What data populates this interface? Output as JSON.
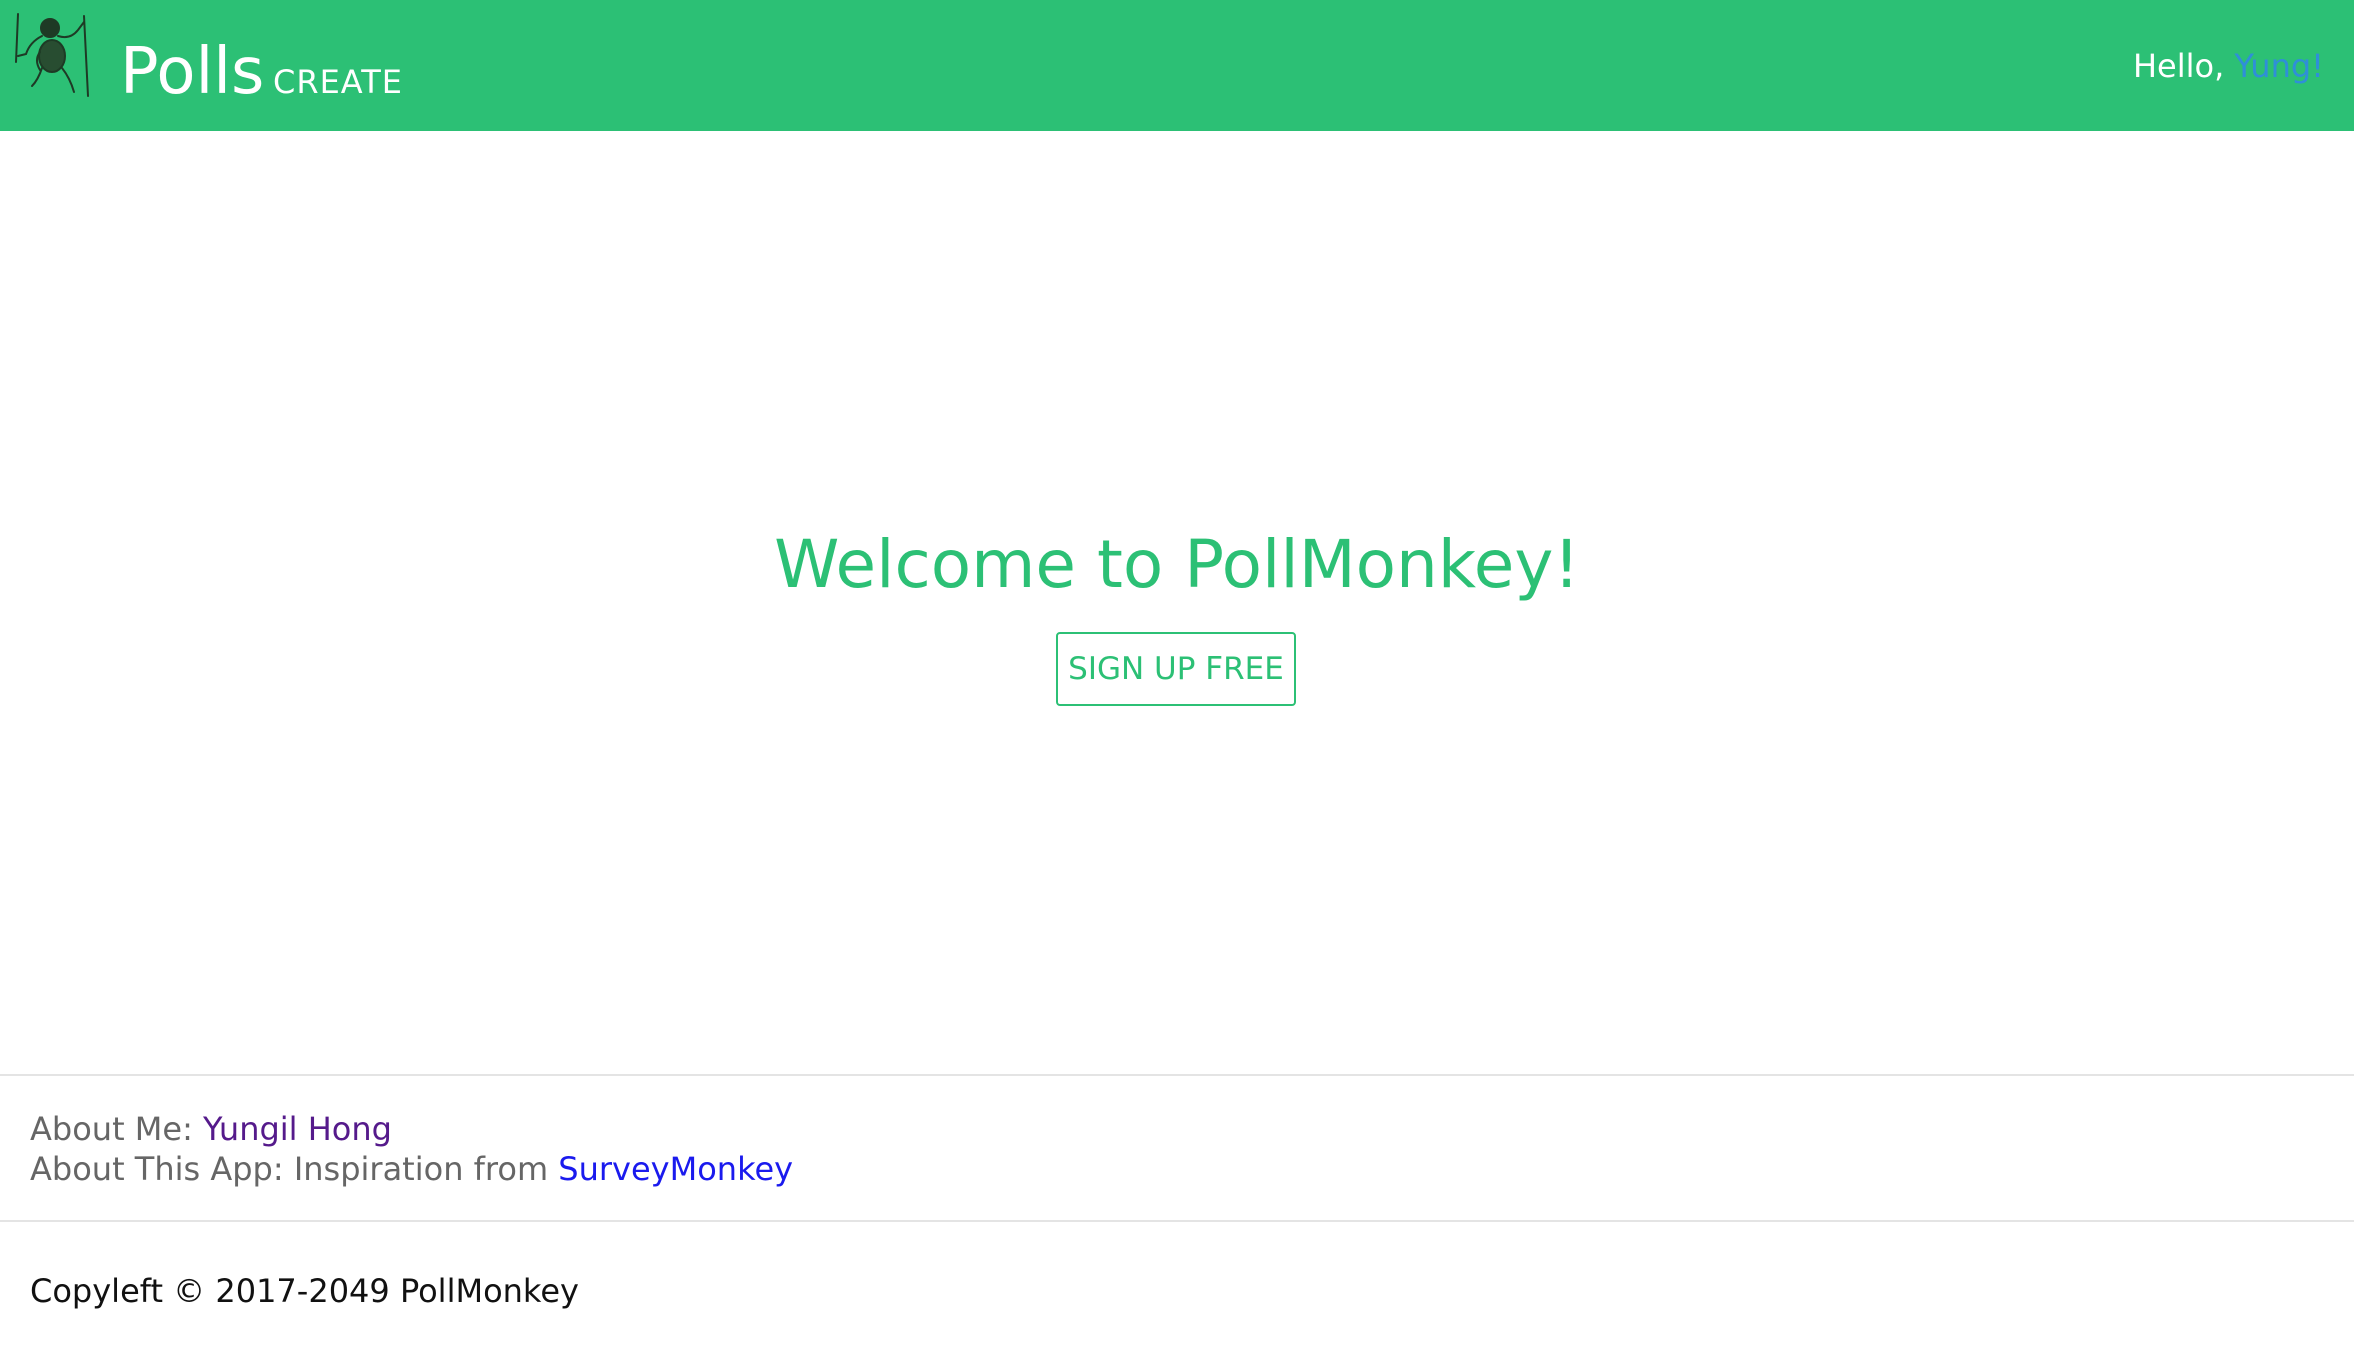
{
  "navbar": {
    "brand": "Polls",
    "create_link": "CREATE",
    "greeting": "Hello,",
    "username": "Yung!",
    "bg_color": "#2cc075",
    "logo_icon": "monkey-logo-icon"
  },
  "hero": {
    "title": "Welcome to PollMonkey!",
    "signup_button": "SIGN UP FREE",
    "accent_color": "#2cc075"
  },
  "footer": {
    "about_me_label": "About Me:",
    "about_me_link": "Yungil Hong",
    "about_app_label": "About This App: Inspiration from",
    "about_app_link": "SurveyMonkey",
    "copyright": "Copyleft © 2017-2049 PollMonkey"
  }
}
